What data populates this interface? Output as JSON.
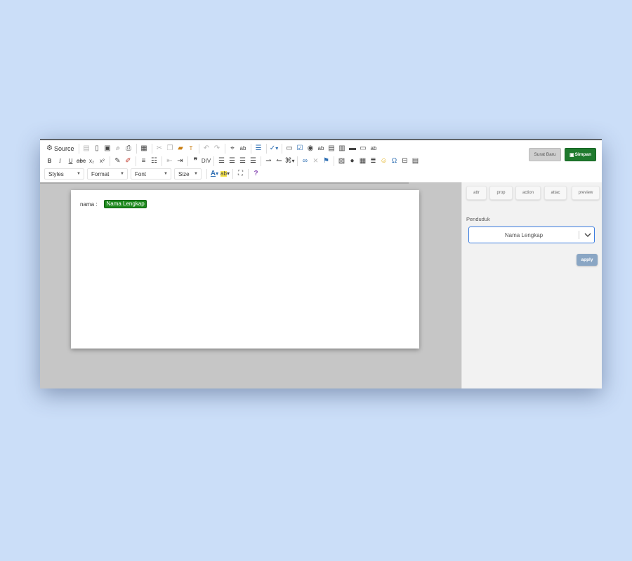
{
  "toolbar": {
    "source_label": "Source",
    "styles_label": "Styles",
    "format_label": "Format",
    "font_label": "Font",
    "size_label": "Size"
  },
  "header": {
    "surat_baru_label": "Surat Baru",
    "simpan_label": "Simpan"
  },
  "editor": {
    "field_label": "nama :",
    "field_value": "Nama Lengkap"
  },
  "side_panel": {
    "tabs": [
      "attr",
      "prop",
      "action",
      "attac",
      "preview"
    ],
    "section_label": "Penduduk",
    "select_value": "Nama Lengkap",
    "apply_label": "apply"
  },
  "colors": {
    "page_background": "#cbdef8",
    "simpan_button": "#1f7a2e",
    "field_tag": "#1d8a1d",
    "select_border": "#3b7de0",
    "apply_button": "#8aa6c4"
  }
}
